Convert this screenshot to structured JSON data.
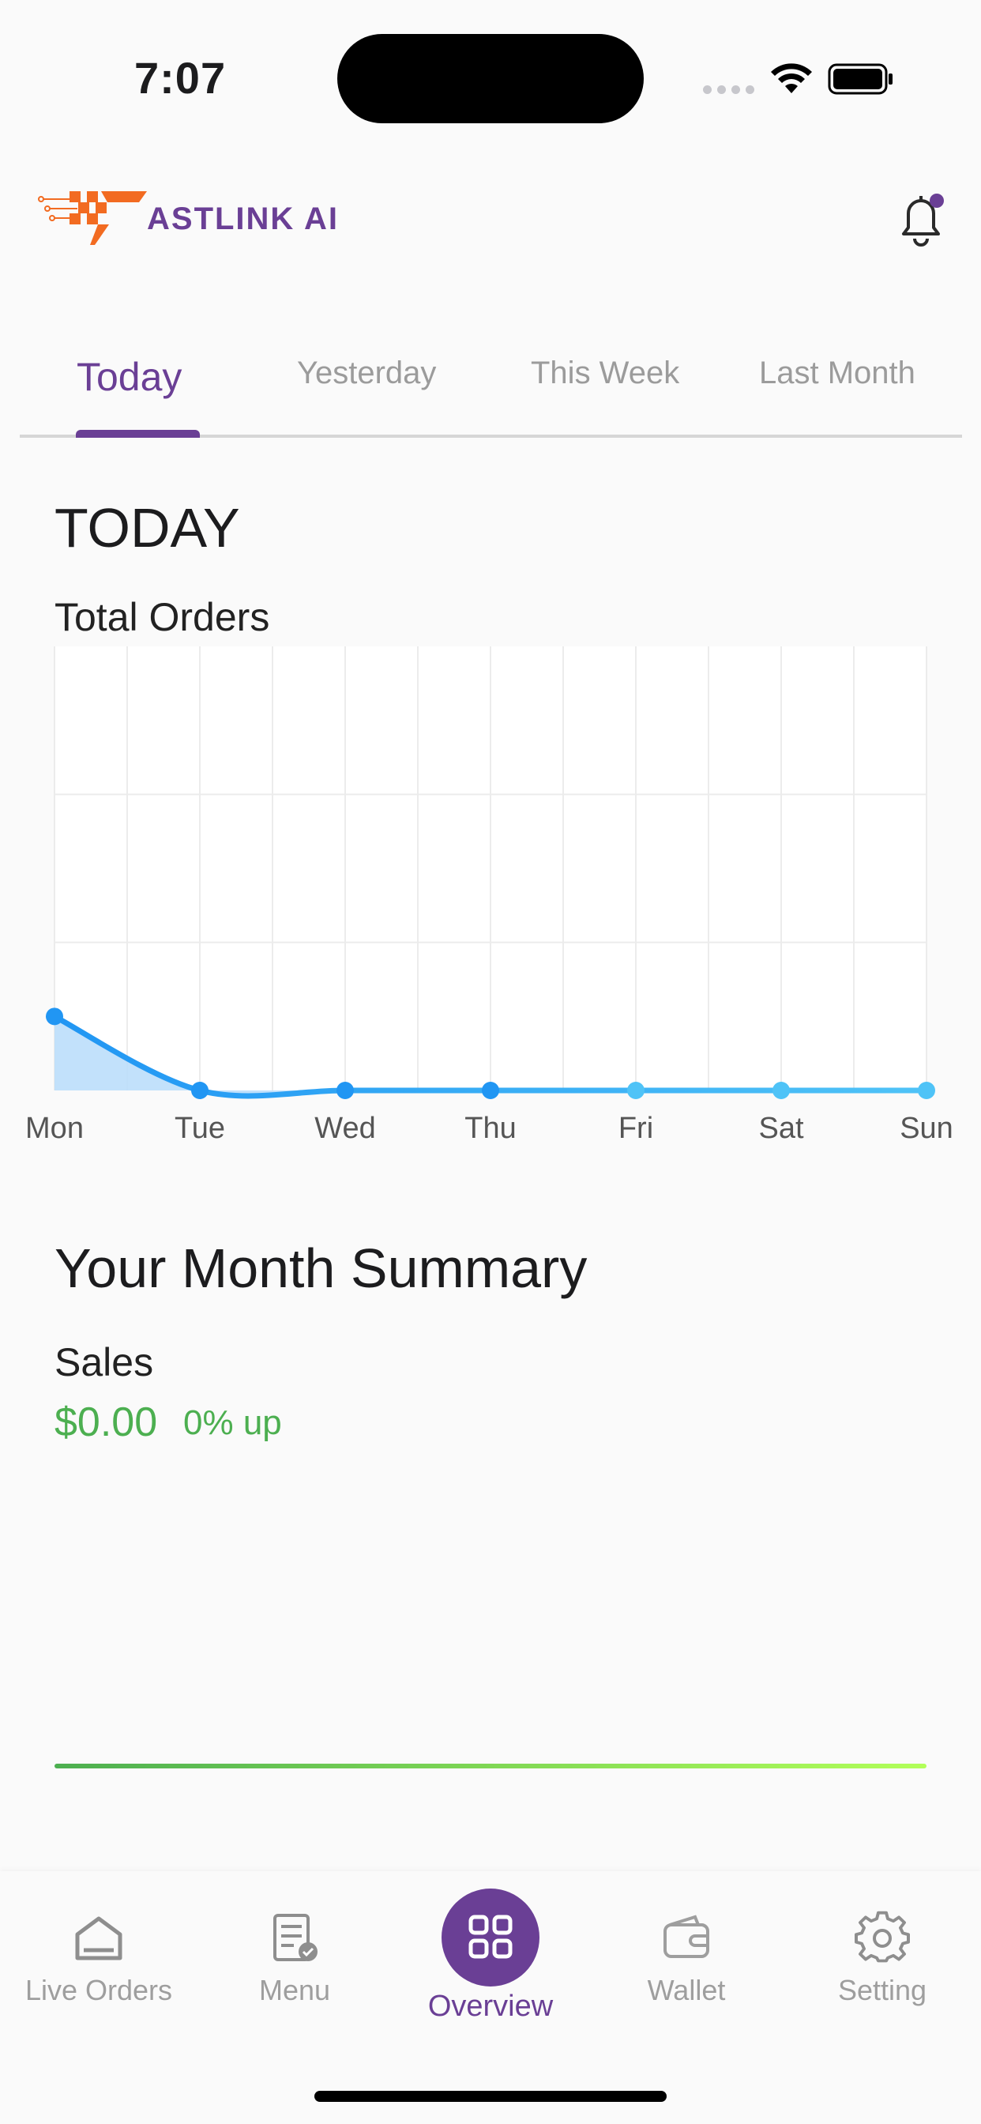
{
  "status_bar": {
    "time": "7:07"
  },
  "header": {
    "brand": "ASTLINK AI"
  },
  "tabs": [
    {
      "label": "Today",
      "active": true
    },
    {
      "label": "Yesterday",
      "active": false
    },
    {
      "label": "This Week",
      "active": false
    },
    {
      "label": "Last Month",
      "active": false
    }
  ],
  "today": {
    "title": "TODAY",
    "chart_label": "Total Orders"
  },
  "chart_data": {
    "type": "line",
    "categories": [
      "Mon",
      "Tue",
      "Wed",
      "Thu",
      "Fri",
      "Sat",
      "Sun"
    ],
    "series": [
      {
        "values": [
          0.2,
          0,
          0,
          0,
          0,
          0,
          0
        ]
      }
    ],
    "ylim": [
      0,
      1.2
    ],
    "grid": true,
    "line_color_start": "#2196f3",
    "line_color_end": "#4fc3f7",
    "area_fill": "#bbdefb"
  },
  "summary": {
    "title": "Your Month Summary",
    "sales_label": "Sales",
    "sales_value": "$0.00",
    "sales_change": "0% up",
    "accent": "#4caf50"
  },
  "bottom_nav": [
    {
      "label": "Live Orders",
      "icon": "home-icon",
      "active": false
    },
    {
      "label": "Menu",
      "icon": "menu-receipt-icon",
      "active": false
    },
    {
      "label": "Overview",
      "icon": "grid-icon",
      "active": true
    },
    {
      "label": "Wallet",
      "icon": "wallet-icon",
      "active": false
    },
    {
      "label": "Setting",
      "icon": "gear-icon",
      "active": false
    }
  ],
  "colors": {
    "brand_purple": "#6a3f95",
    "brand_orange": "#f26b21"
  }
}
